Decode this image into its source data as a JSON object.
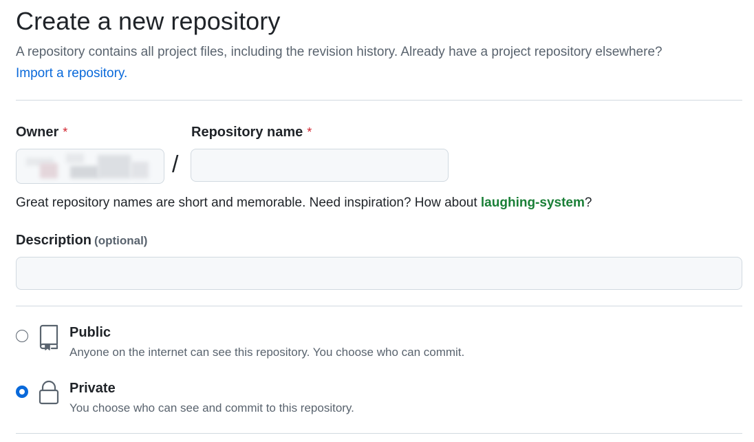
{
  "header": {
    "title": "Create a new repository",
    "subtitle": "A repository contains all project files, including the revision history. Already have a project repository elsewhere?",
    "import_link": "Import a repository."
  },
  "owner": {
    "label": "Owner",
    "required_mark": "*"
  },
  "repo_name": {
    "label": "Repository name",
    "required_mark": "*",
    "value": "",
    "separator": "/"
  },
  "hint": {
    "text": "Great repository names are short and memorable. Need inspiration? How about ",
    "suggestion": "laughing-system",
    "suffix": "?"
  },
  "description": {
    "label": "Description",
    "optional": "(optional)",
    "value": ""
  },
  "visibility": {
    "selected": "private",
    "options": [
      {
        "id": "public",
        "title": "Public",
        "description": "Anyone on the internet can see this repository. You choose who can commit.",
        "icon": "repo-icon"
      },
      {
        "id": "private",
        "title": "Private",
        "description": "You choose who can see and commit to this repository.",
        "icon": "lock-icon"
      }
    ]
  },
  "colors": {
    "link": "#0969da",
    "suggestion": "#1a7f37",
    "required": "#d1242f",
    "radio_checked": "#0969da"
  }
}
